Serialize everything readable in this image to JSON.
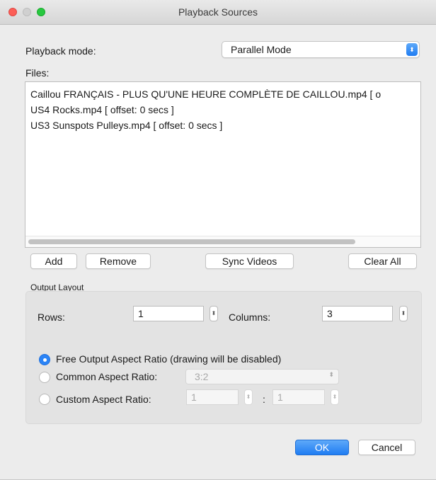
{
  "window": {
    "title": "Playback Sources"
  },
  "playback_mode": {
    "label": "Playback mode:",
    "selected": "Parallel Mode"
  },
  "files": {
    "label": "Files:",
    "items": [
      "Caillou FRANÇAIS - PLUS QU'UNE HEURE COMPLÈTE DE CAILLOU.mp4 [ o",
      "US4 Rocks.mp4 [ offset: 0 secs ]",
      "US3 Sunspots Pulleys.mp4 [ offset: 0 secs ]"
    ]
  },
  "file_buttons": {
    "add": "Add",
    "remove": "Remove",
    "sync": "Sync Videos",
    "clear_all": "Clear All"
  },
  "output_layout": {
    "title": "Output Layout",
    "rows_label": "Rows:",
    "rows_value": "1",
    "columns_label": "Columns:",
    "columns_value": "3",
    "free_ratio_label": "Free Output Aspect Ratio (drawing will be disabled)",
    "common_ratio_label": "Common Aspect Ratio:",
    "common_ratio_value": "3:2",
    "custom_ratio_label": "Custom Aspect Ratio:",
    "custom_ratio_w": "1",
    "custom_ratio_sep": ":",
    "custom_ratio_h": "1",
    "selected_option": "free"
  },
  "dialog_buttons": {
    "ok": "OK",
    "cancel": "Cancel"
  },
  "colors": {
    "accent": "#2b84f6",
    "close": "#fc5f57",
    "zoom": "#28c840"
  }
}
